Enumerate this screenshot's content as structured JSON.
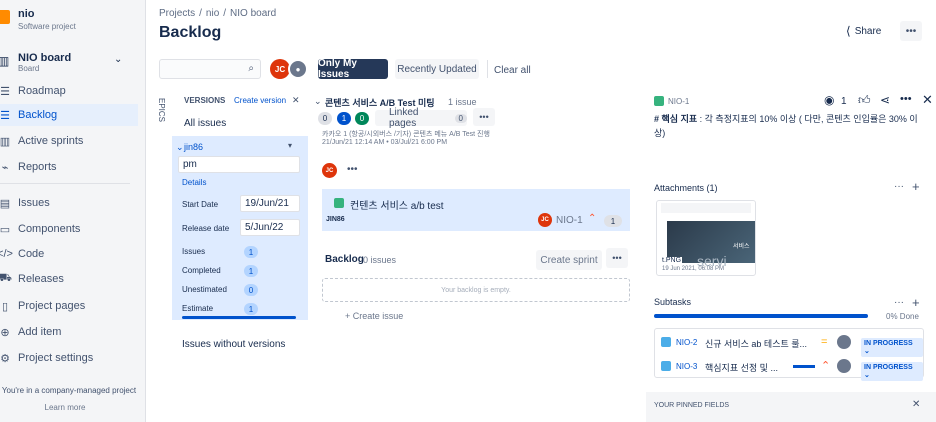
{
  "sidebar": {
    "project_name": "nio",
    "project_type": "Software project",
    "board_name": "NIO board",
    "board_type": "Board",
    "nav": [
      "Roadmap",
      "Backlog",
      "Active sprints",
      "Reports"
    ],
    "nav2": [
      "Issues",
      "Components",
      "Code",
      "Releases",
      "Project pages",
      "Add item",
      "Project settings"
    ],
    "footer_text": "You're in a company-managed project",
    "learn_more": "Learn more"
  },
  "header": {
    "breadcrumb": [
      "Projects",
      "/",
      "nio",
      "/",
      "NIO board"
    ],
    "title": "Backlog",
    "share": "Share",
    "more": "•••"
  },
  "filters": {
    "search_placeholder": "",
    "avatar_initials": "JC",
    "only_my_issues": "Only My Issues",
    "recently_updated": "Recently Updated",
    "clear_all": "Clear all"
  },
  "epics_label": "EPICS",
  "versions": {
    "heading": "VERSIONS",
    "create": "Create version",
    "close": "✕",
    "all_issues": "All issues",
    "version_name": "jin86",
    "name_value": "pm",
    "details": "Details",
    "start_date_label": "Start Date",
    "start_date": "19/Jun/21",
    "release_date_label": "Release date",
    "release_date": "5/Jun/22",
    "issues_label": "Issues",
    "issues": "1",
    "completed_label": "Completed",
    "completed": "1",
    "unestimated_label": "Unestimated",
    "unestimated": "0",
    "estimate_label": "Estimate",
    "estimate": "1",
    "without_versions": "Issues without versions"
  },
  "sprint": {
    "title": "콘텐츠 서비스 A/B Test 미팅",
    "count": "1 issue",
    "badge_grey": "0",
    "badge_blue": "1",
    "badge_green": "0",
    "linked_pages": "Linked pages",
    "linked_count": "0",
    "dots": "•••",
    "description": "카카오 1 (항공/시외버스 /기자) 콘텐츠 메뉴 A/B Test 진행",
    "dates": "21/Jun/21 12:14 AM • 03/Jul/21 6:00 PM",
    "issue_summary": "컨텐츠 서비스 a/b test",
    "issue_label": "JIN86",
    "issue_key": "NIO-1",
    "issue_points": "1"
  },
  "backlog": {
    "title": "Backlog",
    "count": "0 issues",
    "create_sprint": "Create sprint",
    "empty": "Your backlog is empty.",
    "create_issue": "+ Create issue"
  },
  "detail": {
    "key": "NIO-1",
    "watch_count": "1",
    "text_bold": "# 핵심 지표 ",
    "text_rest": ": 각 측정지표의 10% 이상 ( 다만, 콘텐츠 인입률은 30% 이상)",
    "attachments": "Attachments (1)",
    "attach_name": "t.PNG",
    "attach_date": "19 Jun 2021, 06:08 PM",
    "thumb_overlay": "servi",
    "thumb_label": "서비스",
    "subtasks": "Subtasks",
    "done": "0% Done",
    "subtasks_list": [
      {
        "key": "NIO-2",
        "summary": "신규 서비스 ab 테스트 룰...",
        "status": "IN PROGRESS ⌄"
      },
      {
        "key": "NIO-3",
        "summary": "핵심지표 선정 및 ...",
        "status": "IN PROGRESS ⌄"
      }
    ],
    "pinned": "YOUR PINNED FIELDS",
    "pinned_close": "✕",
    "plus": "+",
    "dots": "···"
  },
  "colors": {
    "brand": "#0052cc",
    "sidebar_bg": "#f4f5f7",
    "selected_bg": "#deebff",
    "avatar": "#de350b",
    "story_green": "#36b37e"
  }
}
